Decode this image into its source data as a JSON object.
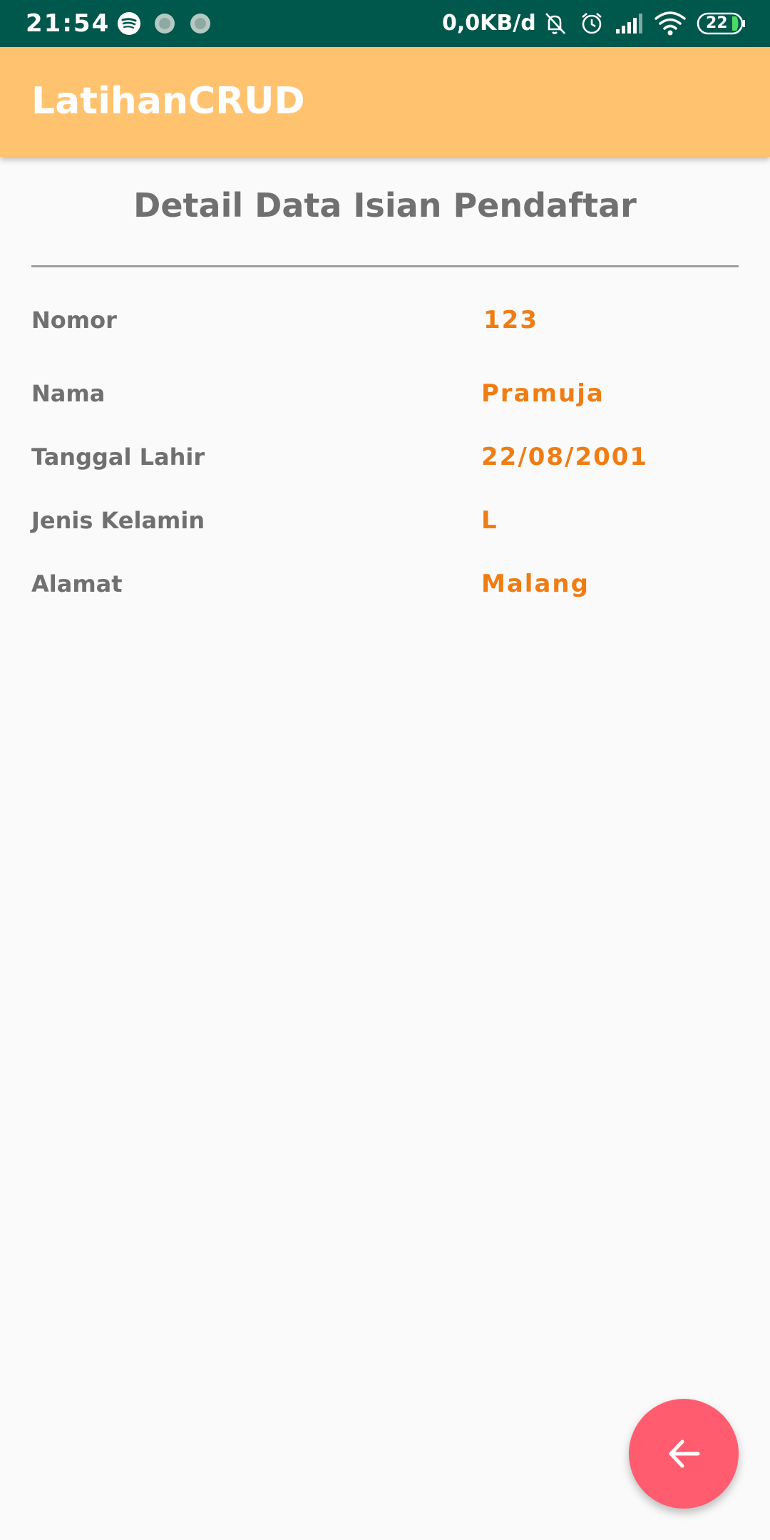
{
  "status_bar": {
    "time": "21:54",
    "network_speed": "0,0KB/d",
    "battery_level": "22",
    "icons": [
      "spotify-icon",
      "notification-dot-icon",
      "notification-dot-icon",
      "mute-icon",
      "alarm-icon",
      "signal-icon",
      "wifi-icon",
      "battery-icon"
    ]
  },
  "app_bar": {
    "title": "LatihanCRUD"
  },
  "detail": {
    "heading": "Detail Data Isian Pendaftar",
    "rows": [
      {
        "label": "Nomor",
        "value": "123"
      },
      {
        "label": "Nama",
        "value": "Pramuja"
      },
      {
        "label": "Tanggal Lahir",
        "value": "22/08/2001"
      },
      {
        "label": "Jenis Kelamin",
        "value": "L"
      },
      {
        "label": "Alamat",
        "value": "Malang"
      }
    ]
  },
  "fab": {
    "icon": "arrow-back-icon"
  },
  "colors": {
    "status_bar": "#00574b",
    "app_bar": "#ffc370",
    "label_text": "#707070",
    "value_text": "#ef7d14",
    "fab": "#ff5c6f",
    "background": "#fafafa"
  }
}
